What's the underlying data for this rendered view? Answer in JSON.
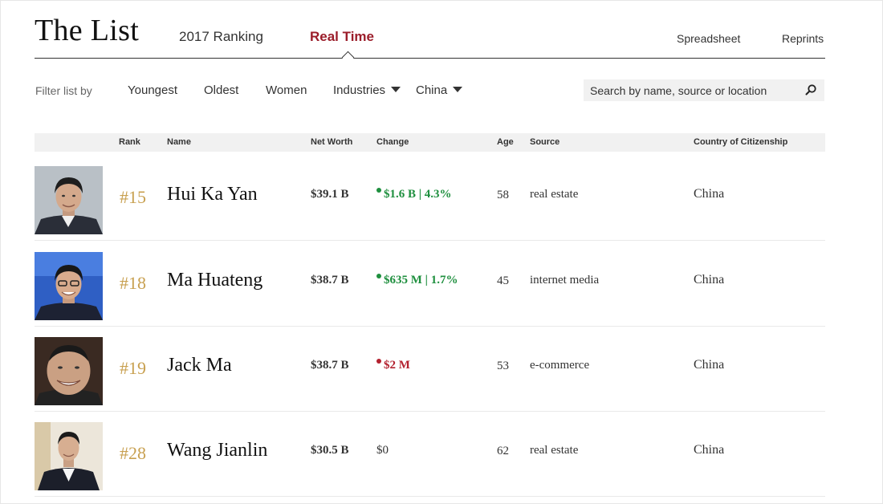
{
  "header": {
    "title": "The List",
    "tabs": [
      {
        "label": "2017 Ranking",
        "active": false
      },
      {
        "label": "Real Time",
        "active": true
      }
    ],
    "links": [
      "Spreadsheet",
      "Reprints"
    ]
  },
  "filters": {
    "label": "Filter list by",
    "options": [
      "Youngest",
      "Oldest",
      "Women"
    ],
    "dropdowns": [
      "Industries",
      "China"
    ]
  },
  "search": {
    "placeholder": "Search by name, source or location",
    "icon": "search-icon"
  },
  "table": {
    "columns": [
      "Rank",
      "Name",
      "Net Worth",
      "Change",
      "Age",
      "Source",
      "Country of Citizenship"
    ],
    "rows": [
      {
        "rank": "#15",
        "name": "Hui Ka Yan",
        "net_worth": "$39.1 B",
        "change": "$1.6 B | 4.3%",
        "change_direction": "up",
        "age": "58",
        "source": "real estate",
        "country": "China"
      },
      {
        "rank": "#18",
        "name": "Ma Huateng",
        "net_worth": "$38.7 B",
        "change": "$635 M | 1.7%",
        "change_direction": "up",
        "age": "45",
        "source": "internet media",
        "country": "China"
      },
      {
        "rank": "#19",
        "name": "Jack Ma",
        "net_worth": "$38.7 B",
        "change": "$2 M",
        "change_direction": "down",
        "age": "53",
        "source": "e-commerce",
        "country": "China"
      },
      {
        "rank": "#28",
        "name": "Wang Jianlin",
        "net_worth": "$30.5 B",
        "change": "$0",
        "change_direction": "none",
        "age": "62",
        "source": "real estate",
        "country": "China"
      }
    ]
  },
  "colors": {
    "accent": "#9b1d2a",
    "rank": "#c8a050",
    "positive": "#1e8f3e",
    "negative": "#b3212f"
  }
}
